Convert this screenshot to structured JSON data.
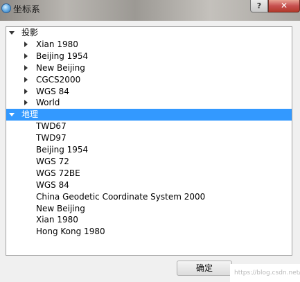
{
  "window": {
    "title": "坐标系",
    "help_label": "?",
    "close_label": "✕"
  },
  "tree": {
    "groups": [
      {
        "label": "投影",
        "expanded": true,
        "selected": false,
        "children": [
          "Xian 1980",
          "Beijing 1954",
          "New Beijing",
          "CGCS2000",
          "WGS 84",
          "World"
        ],
        "children_expandable": true
      },
      {
        "label": "地理",
        "expanded": true,
        "selected": true,
        "children": [
          "TWD67",
          "TWD97",
          "Beijing 1954",
          "WGS 72",
          "WGS 72BE",
          "WGS 84",
          "China Geodetic Coordinate System 2000",
          "New Beijing",
          "Xian 1980",
          "Hong Kong 1980"
        ],
        "children_expandable": false
      }
    ]
  },
  "buttons": {
    "ok_label": "确定"
  },
  "watermark": "https://blog.csdn.net/...",
  "colors": {
    "selection": "#3399ff",
    "close_button": "#c75050"
  }
}
